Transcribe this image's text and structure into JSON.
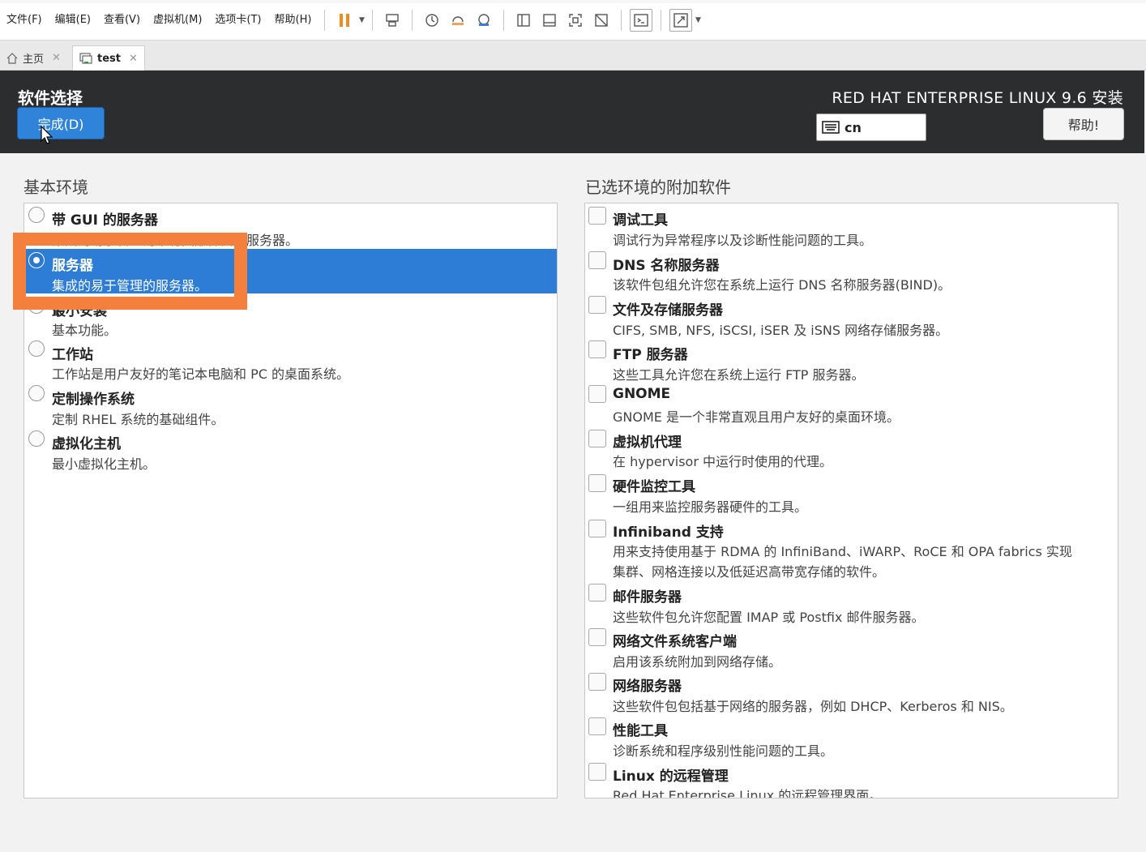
{
  "menu": {
    "items": [
      "文件(F)",
      "编辑(E)",
      "查看(V)",
      "虚拟机(M)",
      "选项卡(T)",
      "帮助(H)"
    ]
  },
  "tabs": [
    {
      "label": "主页",
      "icon": "home-icon"
    },
    {
      "label": "test",
      "icon": "vm-icon"
    }
  ],
  "header": {
    "title": "软件选择",
    "done_label": "完成(D)",
    "product": "RED HAT ENTERPRISE LINUX 9.6 安装",
    "keyboard": "cn",
    "help_label": "帮助!"
  },
  "base_env": {
    "title": "基本环境",
    "items": [
      {
        "name": "带 GUI 的服务器",
        "desc": "集成的易于管理的带有图形界面的服务器。",
        "selected": false
      },
      {
        "name": "服务器",
        "desc": "集成的易于管理的服务器。",
        "selected": true
      },
      {
        "name": "最小安装",
        "desc": "基本功能。",
        "selected": false
      },
      {
        "name": "工作站",
        "desc": "工作站是用户友好的笔记本电脑和 PC 的桌面系统。",
        "selected": false
      },
      {
        "name": "定制操作系统",
        "desc": "定制 RHEL 系统的基础组件。",
        "selected": false
      },
      {
        "name": "虚拟化主机",
        "desc": "最小虚拟化主机。",
        "selected": false
      }
    ]
  },
  "addons": {
    "title": "已选环境的附加软件",
    "items": [
      {
        "name": "调试工具",
        "desc": "调试行为异常程序以及诊断性能问题的工具。"
      },
      {
        "name": "DNS 名称服务器",
        "desc": "该软件包组允许您在系统上运行 DNS 名称服务器(BIND)。"
      },
      {
        "name": "文件及存储服务器",
        "desc": "CIFS, SMB, NFS, iSCSI, iSER 及 iSNS 网络存储服务器。"
      },
      {
        "name": "FTP 服务器",
        "desc": "这些工具允许您在系统上运行 FTP 服务器。"
      },
      {
        "name": "GNOME",
        "desc": "GNOME 是一个非常直观且用户友好的桌面环境。"
      },
      {
        "name": "虚拟机代理",
        "desc": "在 hypervisor 中运行时使用的代理。"
      },
      {
        "name": "硬件监控工具",
        "desc": "一组用来监控服务器硬件的工具。"
      },
      {
        "name": "Infiniband 支持",
        "desc": "用来支持使用基于 RDMA 的 InfiniBand、iWARP、RoCE 和 OPA fabrics 实现",
        "desc2": "集群、网格连接以及低延迟高带宽存储的软件。"
      },
      {
        "name": "邮件服务器",
        "desc": "这些软件包允许您配置 IMAP 或 Postfix 邮件服务器。"
      },
      {
        "name": "网络文件系统客户端",
        "desc": "启用该系统附加到网络存储。"
      },
      {
        "name": "网络服务器",
        "desc": "这些软件包包括基于网络的服务器，例如 DHCP、Kerberos 和 NIS。"
      },
      {
        "name": "性能工具",
        "desc": "诊断系统和程序级别性能问题的工具。"
      },
      {
        "name": "Linux 的远程管理",
        "desc": "Red Hat Enterprise Linux 的远程管理界面。"
      }
    ]
  },
  "colors": {
    "header_bg": "#2b2d2f",
    "accent": "#2d7cd6",
    "highlight": "#f5803e"
  }
}
